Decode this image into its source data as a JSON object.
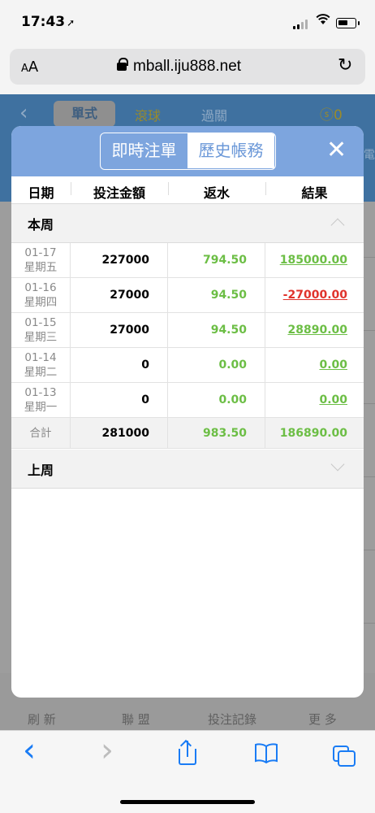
{
  "status_bar": {
    "time": "17:43",
    "location_arrow": "➚"
  },
  "browser": {
    "aa_big": "A",
    "aa_small": "A",
    "url": "mball.iju888.net",
    "reload_icon": "↻"
  },
  "background": {
    "back_icon": "‹",
    "tabs": [
      "單式",
      "滾球",
      "過關"
    ],
    "money": "ⓢ0",
    "side_text": "電",
    "bottom_nav": [
      "刷 新",
      "聯 盟",
      "投注記錄",
      "更 多"
    ]
  },
  "modal": {
    "segment": {
      "live": "即時注單",
      "history": "歷史帳務"
    },
    "close_icon": "✕",
    "columns": [
      "日期",
      "投注金額",
      "返水",
      "結果"
    ],
    "this_week": {
      "label": "本周",
      "rows": [
        {
          "date": "01-17",
          "weekday": "星期五",
          "amount": "227000",
          "rebate": "794.50",
          "result": "185000.00",
          "result_sign": "pos"
        },
        {
          "date": "01-16",
          "weekday": "星期四",
          "amount": "27000",
          "rebate": "94.50",
          "result": "-27000.00",
          "result_sign": "neg"
        },
        {
          "date": "01-15",
          "weekday": "星期三",
          "amount": "27000",
          "rebate": "94.50",
          "result": "28890.00",
          "result_sign": "pos"
        },
        {
          "date": "01-14",
          "weekday": "星期二",
          "amount": "0",
          "rebate": "0.00",
          "result": "0.00",
          "result_sign": "pos"
        },
        {
          "date": "01-13",
          "weekday": "星期一",
          "amount": "0",
          "rebate": "0.00",
          "result": "0.00",
          "result_sign": "pos"
        }
      ],
      "total": {
        "label": "合計",
        "amount": "281000",
        "rebate": "983.50",
        "result": "186890.00"
      }
    },
    "last_week": {
      "label": "上周"
    }
  },
  "colors": {
    "header_blue": "#7da5de",
    "positive": "#6cbe45",
    "negative": "#e0332c",
    "ios_blue": "#1a7cf5"
  },
  "toolbar": {
    "back_icon": "‹",
    "forward_icon": "›",
    "bookmarks_icon": "📖"
  }
}
